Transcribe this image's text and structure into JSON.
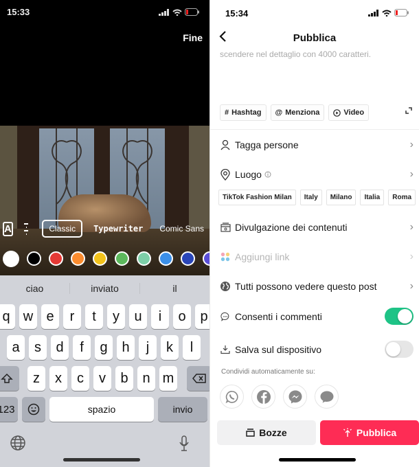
{
  "left": {
    "status_time": "15:33",
    "done_label": "Fine",
    "text_style_icon": "A",
    "fonts": [
      "Classic",
      "Typewriter",
      "Comic Sans"
    ],
    "selected_font": "Classic",
    "colors": [
      "#ffffff",
      "#000000",
      "#e53935",
      "#fb8c2f",
      "#f2c21b",
      "#5cb85c",
      "#7dcfa8",
      "#3b8fe8",
      "#2a46b8",
      "#5b4fd8"
    ],
    "keyboard": {
      "suggestions": [
        "ciao",
        "inviato",
        "il"
      ],
      "row1": [
        "q",
        "w",
        "e",
        "r",
        "t",
        "y",
        "u",
        "i",
        "o",
        "p"
      ],
      "row2": [
        "a",
        "s",
        "d",
        "f",
        "g",
        "h",
        "j",
        "k",
        "l"
      ],
      "row3": [
        "z",
        "x",
        "c",
        "v",
        "b",
        "n",
        "m"
      ],
      "numbers_label": "123",
      "space_label": "spazio",
      "return_label": "invio"
    }
  },
  "right": {
    "status_time": "15:34",
    "title": "Pubblica",
    "description_placeholder": "scendere nel dettaglio con 4000 caratteri.",
    "chips": [
      {
        "icon": "#",
        "label": "Hashtag"
      },
      {
        "icon": "@",
        "label": "Menziona"
      },
      {
        "icon": "▶",
        "label": "Video"
      }
    ],
    "tag_people": "Tagga persone",
    "location": "Luogo",
    "location_suggestions": [
      "TikTok Fashion Milan",
      "Italy",
      "Milano",
      "Italia",
      "Roma"
    ],
    "content_disclosure": "Divulgazione dei contenuti",
    "add_link": "Aggiungi link",
    "visibility": "Tutti possono vedere questo post",
    "allow_comments": {
      "label": "Consenti i commenti",
      "on": true
    },
    "save_device": {
      "label": "Salva sul dispositivo",
      "on": false
    },
    "share_label": "Condividi automaticamente su:",
    "share_targets": [
      "whatsapp",
      "facebook",
      "messenger",
      "sms"
    ],
    "drafts_label": "Bozze",
    "publish_label": "Pubblica",
    "accent_color": "#fe2c55",
    "toggle_on_color": "#1ec386"
  }
}
